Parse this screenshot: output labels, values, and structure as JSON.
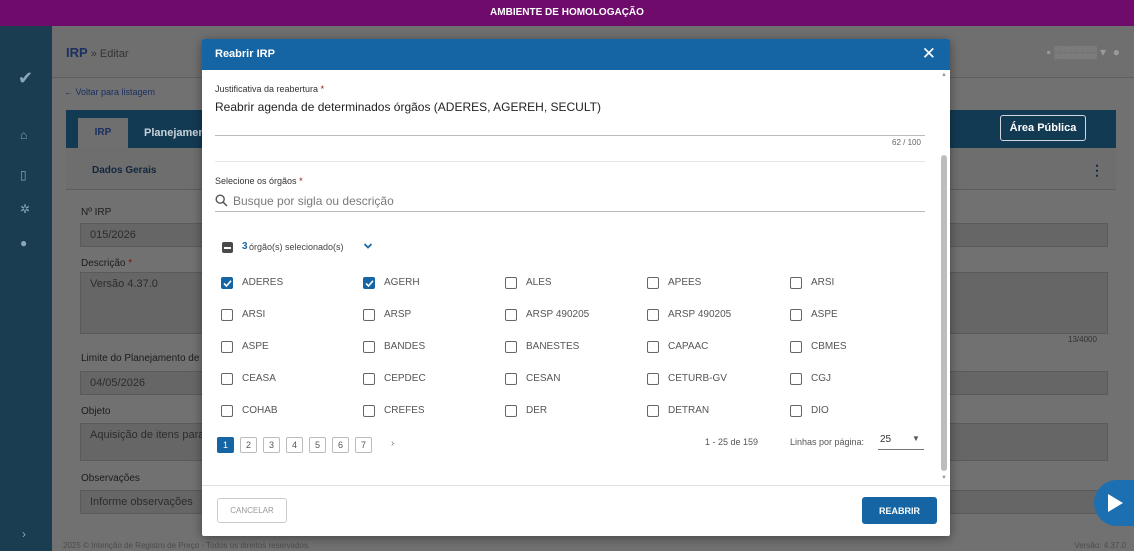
{
  "env_banner": "AMBIENTE DE HOMOLOGAÇÃO",
  "app": {
    "title": "IRP",
    "breadcrumb": " » Editar",
    "back_link": "← Voltar para listagem",
    "tabs": [
      "IRP",
      "Planejamen"
    ],
    "area_publica": "Área Pública",
    "subtab": "Dados Gerais",
    "fields": {
      "irp_label": "Nº IRP",
      "irp_value": "015/2026",
      "descricao_label": "Descrição",
      "descricao_value": "Versão 4.37.0",
      "descricao_counter": "13/4000",
      "limite_label": "Limite do Planejamento de",
      "limite_value": "04/05/2026",
      "objeto_label": "Objeto",
      "objeto_value": "Aquisição de itens para",
      "obs_label": "Observações",
      "obs_placeholder": "Informe observações"
    },
    "footer_text": "2025 © Intenção de Registro de Preço - Todos os direitos reservados.",
    "footer_version": "Versão: 4.37.0"
  },
  "modal": {
    "title": "Reabrir IRP",
    "justificativa_label": "Justificativa da reabertura",
    "required_mark": "*",
    "justificativa_value": "Reabrir agenda de determinados órgãos (ADERES, AGEREH, SECULT)",
    "justificativa_counter": "62 / 100",
    "orgaos_label": "Selecione os órgãos",
    "search_placeholder": "Busque por sigla ou descrição",
    "selected_count": "3",
    "selected_text": "órgão(s) selecionado(s)",
    "orgaos": [
      {
        "name": "ADERES",
        "checked": true
      },
      {
        "name": "AGERH",
        "checked": true
      },
      {
        "name": "ALES",
        "checked": false
      },
      {
        "name": "APEES",
        "checked": false
      },
      {
        "name": "ARSI",
        "checked": false
      },
      {
        "name": "ARSI",
        "checked": false
      },
      {
        "name": "ARSP",
        "checked": false
      },
      {
        "name": "ARSP 490205",
        "checked": false
      },
      {
        "name": "ARSP 490205",
        "checked": false
      },
      {
        "name": "ASPE",
        "checked": false
      },
      {
        "name": "ASPE",
        "checked": false
      },
      {
        "name": "BANDES",
        "checked": false
      },
      {
        "name": "BANESTES",
        "checked": false
      },
      {
        "name": "CAPAAC",
        "checked": false
      },
      {
        "name": "CBMES",
        "checked": false
      },
      {
        "name": "CEASA",
        "checked": false
      },
      {
        "name": "CEPDEC",
        "checked": false
      },
      {
        "name": "CESAN",
        "checked": false
      },
      {
        "name": "CETURB-GV",
        "checked": false
      },
      {
        "name": "CGJ",
        "checked": false
      },
      {
        "name": "COHAB",
        "checked": false
      },
      {
        "name": "CREFES",
        "checked": false
      },
      {
        "name": "DER",
        "checked": false
      },
      {
        "name": "DETRAN",
        "checked": false
      },
      {
        "name": "DIO",
        "checked": false
      }
    ],
    "pages": [
      "1",
      "2",
      "3",
      "4",
      "5",
      "6",
      "7"
    ],
    "active_page": "1",
    "next_symbol": "›",
    "range_text": "1 - 25 de 159",
    "rows_label": "Linhas por página:",
    "rows_value": "25",
    "cancel_label": "CANCELAR",
    "submit_label": "REABRIR"
  },
  "colors": {
    "env_banner": "#6e0b6b",
    "primary": "#1565a4",
    "sidebar": "#1a3d52"
  }
}
